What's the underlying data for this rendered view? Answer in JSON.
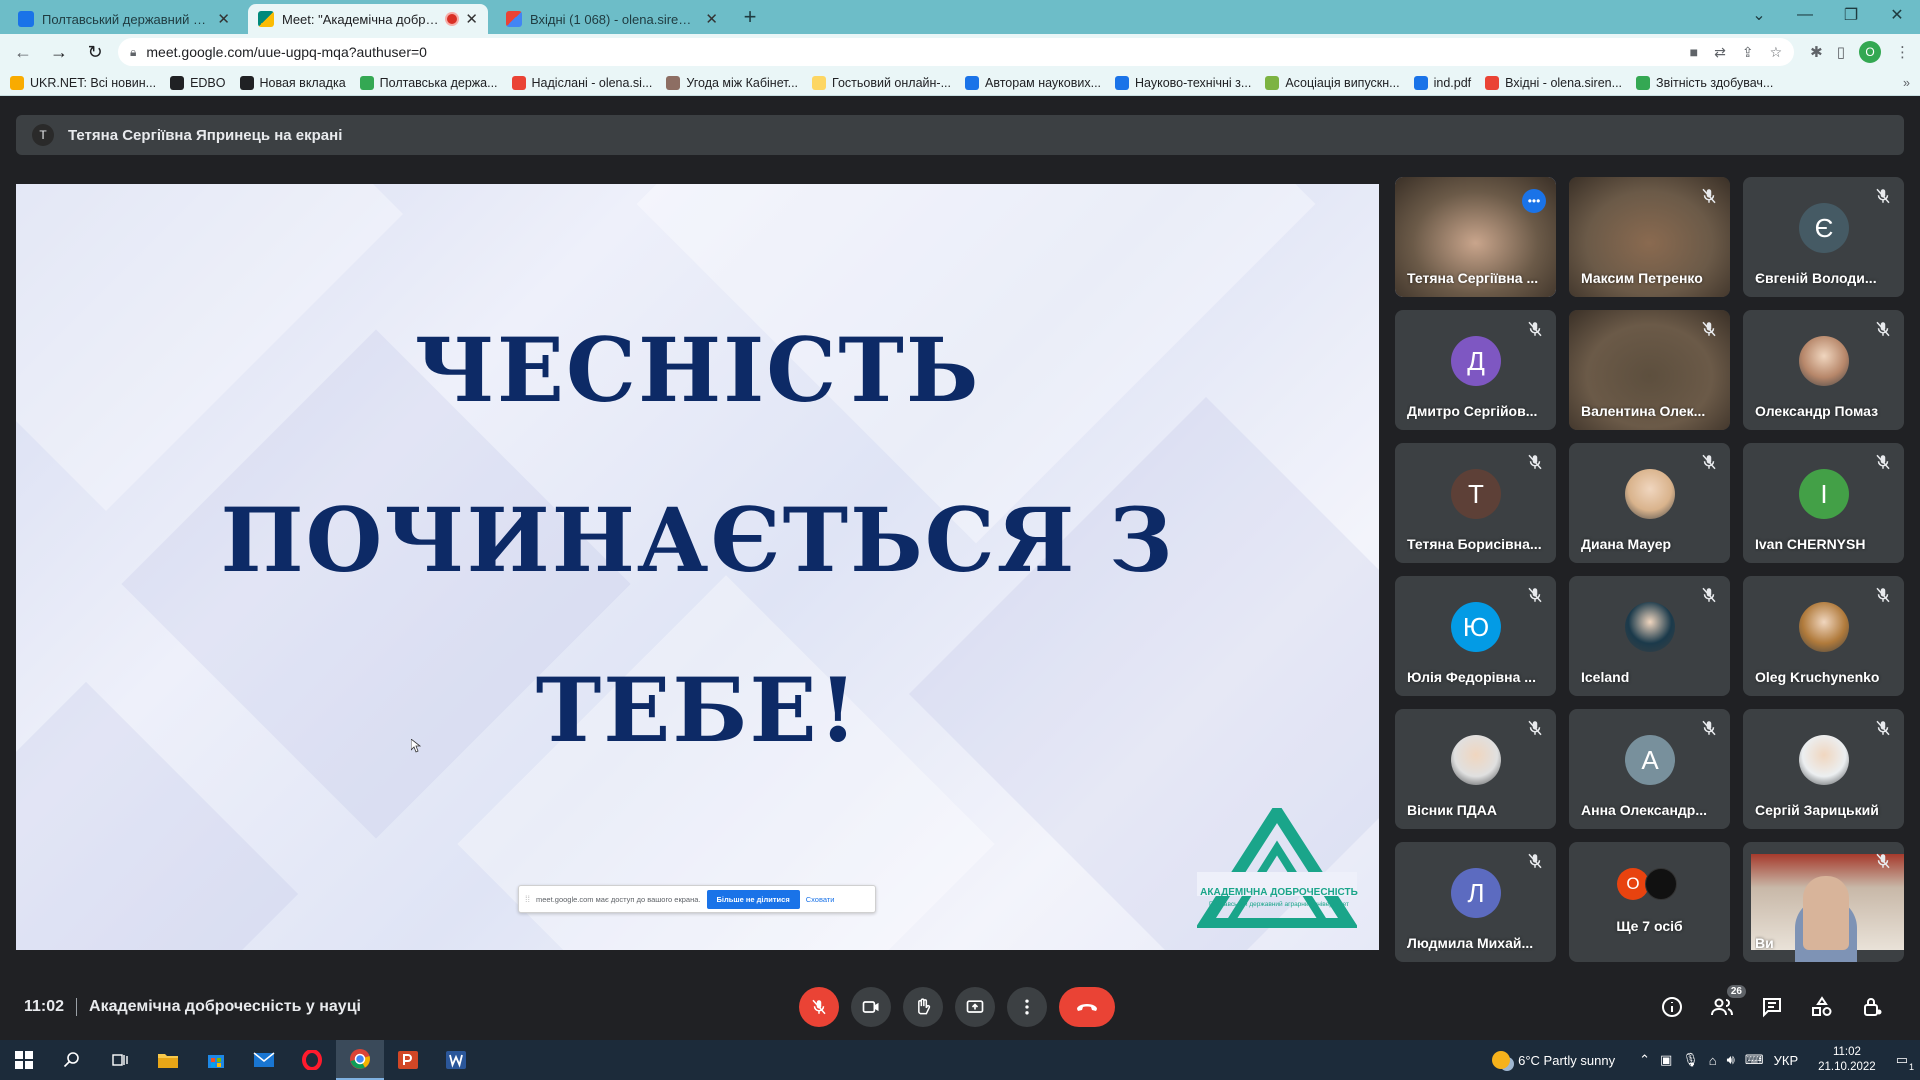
{
  "browser": {
    "tabs": [
      {
        "title": "Полтавський державний аграрн",
        "active": false,
        "icon_color": "#1a73e8"
      },
      {
        "title": "Meet: \"Академічна доброче",
        "active": true,
        "icon_color": "#00897b",
        "recording": true
      },
      {
        "title": "Вхідні (1 068) - olena.sirenko@p",
        "active": false,
        "icon_color": "#ea4335"
      }
    ],
    "url": "meet.google.com/uue-ugpq-mqa?authuser=0",
    "profile_initial": "O",
    "bookmarks": [
      {
        "label": "UKR.NET: Всі новин...",
        "color": "#f9ab00"
      },
      {
        "label": "EDBO",
        "color": "#202124"
      },
      {
        "label": "Новая вкладка",
        "color": "#202124"
      },
      {
        "label": "Полтавська держа...",
        "color": "#34a853"
      },
      {
        "label": "Надіслані - olena.si...",
        "color": "#ea4335"
      },
      {
        "label": "Угода між Кабінет...",
        "color": "#8d6e63"
      },
      {
        "label": "Гостьовий онлайн-...",
        "color": "#fdd663"
      },
      {
        "label": "Авторам наукових...",
        "color": "#1a73e8"
      },
      {
        "label": "Науково-технічні з...",
        "color": "#1a73e8"
      },
      {
        "label": "Асоціація випускн...",
        "color": "#7cb342"
      },
      {
        "label": "ind.pdf",
        "color": "#1a73e8"
      },
      {
        "label": "Вхідні - olena.siren...",
        "color": "#ea4335"
      },
      {
        "label": "Звітність здобувач...",
        "color": "#34a853"
      }
    ]
  },
  "meet": {
    "presenter_initial": "Т",
    "presenter_banner": "Тетяна Сергіївна Япринець на екрані",
    "slide": {
      "line1": "ЧЕСНІСТЬ",
      "line2": "ПОЧИНАЄТЬСЯ З",
      "line3": "ТЕБЕ!",
      "logo_title": "АКАДЕМІЧНА ДОБРОЧЕСНІСТЬ",
      "logo_subtitle": "Полтавський державний аграрний університет",
      "share_notice": "meet.google.com має доступ до вашого екрана.",
      "share_stop": "Більше не ділитися",
      "share_hide": "Сховати"
    },
    "participants": [
      {
        "name": "Тетяна Сергіївна ...",
        "initial": "",
        "color": "#c9a58c",
        "video": true,
        "speaking": true
      },
      {
        "name": "Максим Петренко",
        "initial": "",
        "color": "#8a6a50",
        "video": true
      },
      {
        "name": "Євгеній Володи...",
        "initial": "Є",
        "color": "#455a64"
      },
      {
        "name": "Дмитро Сергійов...",
        "initial": "Д",
        "color": "#7e57c2"
      },
      {
        "name": "Валентина Олек...",
        "initial": "",
        "color": "#5d4f3e",
        "video": true
      },
      {
        "name": "Олександр Помаз",
        "initial": "",
        "color": "#b7876a",
        "photo": true
      },
      {
        "name": "Тетяна Борисівна...",
        "initial": "Т",
        "color": "#5d4037"
      },
      {
        "name": "Диана Мауер",
        "initial": "",
        "color": "#d9b38c",
        "photo": true
      },
      {
        "name": "Ivan CHERNYSH",
        "initial": "I",
        "color": "#43a047"
      },
      {
        "name": "Юлія Федорівна ...",
        "initial": "Ю",
        "color": "#039be5"
      },
      {
        "name": "Iceland",
        "initial": "",
        "color": "#1b3a4b",
        "photo": true
      },
      {
        "name": "Oleg Kruchynenko",
        "initial": "",
        "color": "#b07a3b",
        "photo": true
      },
      {
        "name": "Вісник ПДАА",
        "initial": "",
        "color": "#e0e0e0",
        "photo": true
      },
      {
        "name": "Анна Олександр...",
        "initial": "А",
        "color": "#78909c"
      },
      {
        "name": "Сергій Зарицький",
        "initial": "",
        "color": "#eceff1",
        "photo": true
      },
      {
        "name": "Людмила Михай...",
        "initial": "Л",
        "color": "#5c6bc0"
      },
      {
        "name": "Ще 7 осіб",
        "initial": "O",
        "color": "#e8430f",
        "others": true
      },
      {
        "name": "Ви",
        "initial": "",
        "color": "#c8b8a8",
        "video": true,
        "self": true
      }
    ],
    "clock": "11:02",
    "meeting_title": "Академічна доброчесність у науці",
    "participant_count": "26"
  },
  "taskbar": {
    "weather": "6°C  Partly sunny",
    "language": "УКР",
    "time": "11:02",
    "date": "21.10.2022",
    "notification_count": "1"
  },
  "colors": {
    "slide_text": "#0d2a66",
    "logo": "#1aa58a",
    "end_call": "#ea4335",
    "meet_bg": "#202124",
    "tile_bg": "#3c4043"
  }
}
